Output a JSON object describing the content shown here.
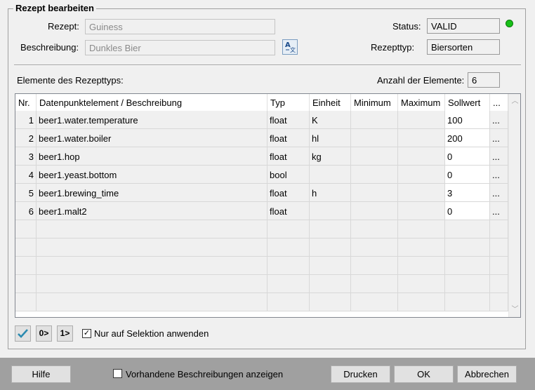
{
  "group_title": "Rezept bearbeiten",
  "recipe": {
    "label": "Rezept:",
    "value": "Guiness",
    "description_label": "Beschreibung:",
    "description_value": "Dunkles Bier"
  },
  "status": {
    "label": "Status:",
    "value": "VALID",
    "led_color": "#18c018"
  },
  "recipe_type": {
    "label": "Rezepttyp:",
    "value": "Biersorten"
  },
  "elements": {
    "label": "Elemente des Rezepttyps:",
    "count_label": "Anzahl der Elemente:",
    "count_value": "6"
  },
  "table": {
    "headers": [
      "Nr.",
      "Datenpunktelement / Beschreibung",
      "Typ",
      "Einheit",
      "Minimum",
      "Maximum",
      "Sollwert",
      "..."
    ],
    "rows": [
      {
        "nr": "1",
        "element": "beer1.water.temperature",
        "typ": "float",
        "einheit": "K",
        "minimum": "",
        "maximum": "",
        "sollwert": "100",
        "more": "..."
      },
      {
        "nr": "2",
        "element": "beer1.water.boiler",
        "typ": "float",
        "einheit": "hl",
        "minimum": "",
        "maximum": "",
        "sollwert": "200",
        "more": "..."
      },
      {
        "nr": "3",
        "element": "beer1.hop",
        "typ": "float",
        "einheit": "kg",
        "minimum": "",
        "maximum": "",
        "sollwert": "0",
        "more": "..."
      },
      {
        "nr": "4",
        "element": "beer1.yeast.bottom",
        "typ": "bool",
        "einheit": "",
        "minimum": "",
        "maximum": "",
        "sollwert": "0",
        "more": "..."
      },
      {
        "nr": "5",
        "element": "beer1.brewing_time",
        "typ": "float",
        "einheit": "h",
        "minimum": "",
        "maximum": "",
        "sollwert": "3",
        "more": "..."
      },
      {
        "nr": "6",
        "element": "beer1.malt2",
        "typ": "float",
        "einheit": "",
        "minimum": "",
        "maximum": "",
        "sollwert": "0",
        "more": "..."
      }
    ],
    "empty_rows": 5
  },
  "toolbar": {
    "apply_icon": "checkmark-icon",
    "set_zero_label": "0>",
    "set_one_label": "1>",
    "selection_only_label": "Nur auf Selektion anwenden",
    "selection_only_checked": true
  },
  "footer": {
    "help_label": "Hilfe",
    "show_descriptions_label": "Vorhandene Beschreibungen anzeigen",
    "show_descriptions_checked": false,
    "print_label": "Drucken",
    "ok_label": "OK",
    "cancel_label": "Abbrechen"
  }
}
